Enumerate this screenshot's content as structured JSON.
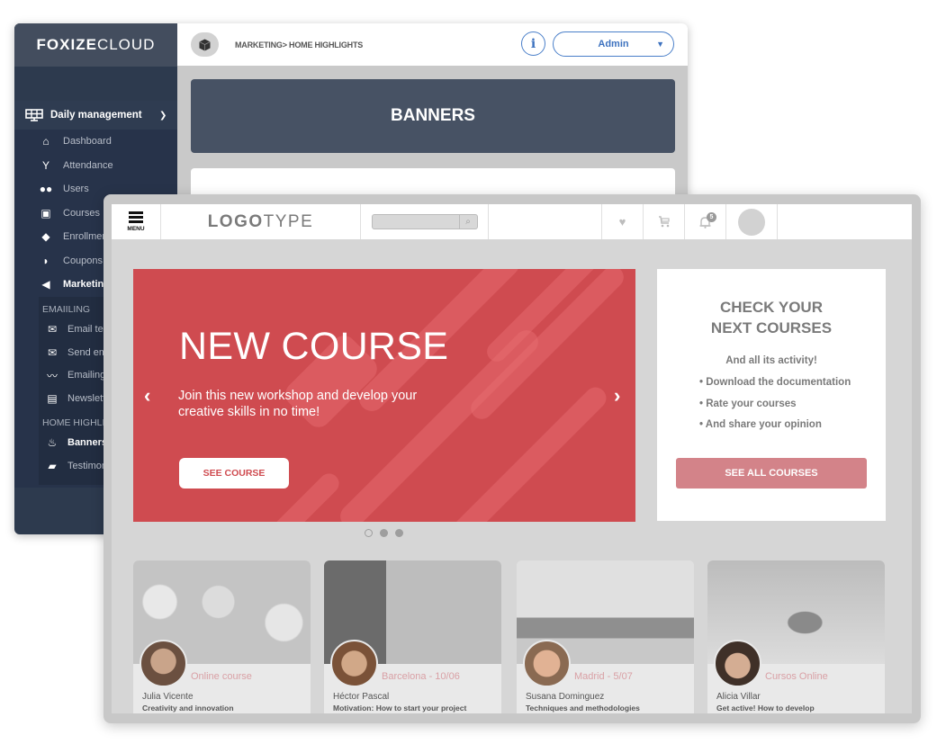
{
  "admin": {
    "brand": {
      "bold": "FOXIZE",
      "light": "CLOUD"
    },
    "sidebar": {
      "group": {
        "label": "Daily management",
        "icon": "solar-panel-icon"
      },
      "items": [
        {
          "label": "Dashboard",
          "icon": "home-icon"
        },
        {
          "label": "Attendance",
          "icon": "person-raised-icon"
        },
        {
          "label": "Users",
          "icon": "users-icon"
        },
        {
          "label": "Courses",
          "icon": "reader-icon"
        },
        {
          "label": "Enrollments",
          "icon": "graduation-cap-icon"
        },
        {
          "label": "Coupons",
          "icon": "tag-icon"
        },
        {
          "label": "Marketing",
          "icon": "megaphone-icon"
        }
      ],
      "emailing": {
        "label": "EMAIILING",
        "items": [
          {
            "label": "Email templates",
            "icon": "envelope-icon"
          },
          {
            "label": "Send emails",
            "icon": "envelope-open-icon"
          },
          {
            "label": "Emailing reports",
            "icon": "line-chart-icon"
          },
          {
            "label": "Newsletters",
            "icon": "newspaper-icon"
          }
        ]
      },
      "home_highlights": {
        "label": "HOME HIGHLIGHTS",
        "items": [
          {
            "label": "Banners",
            "icon": "fire-icon"
          },
          {
            "label": "Testimonials",
            "icon": "comment-icon"
          }
        ]
      }
    },
    "topbar": {
      "breadcrumb": "MARKETING> HOME HIGHLIGHTS",
      "info_label": "i",
      "user_label": "Admin"
    },
    "page_title": "BANNERS"
  },
  "site": {
    "header": {
      "menu_label": "MENU",
      "logo": {
        "bold": "LOGO",
        "light": "TYPE"
      },
      "search_placeholder": "",
      "notification_count": "5"
    },
    "hero": {
      "title": "NEW COURSE",
      "subtitle": "Join this new workshop and develop your creative skills in no time!",
      "button": "SEE COURSE",
      "prev": "‹",
      "next": "›",
      "slides": 3,
      "active_slide": 1
    },
    "promo": {
      "title_line1": "CHECK YOUR",
      "title_line2": "NEXT COURSES",
      "subtitle": "And all its activity!",
      "list": [
        "• Download the documentation",
        "• Rate your courses",
        "• And share your opinion"
      ],
      "button": "SEE ALL COURSES"
    },
    "cards": [
      {
        "tag": "Online course",
        "name": "Julia Vicente",
        "course": "Creativity and innovation"
      },
      {
        "tag": "Barcelona - 10/06",
        "name": "Héctor Pascal",
        "course": "Motivation: How to start your project"
      },
      {
        "tag": "Madrid - 5/07",
        "name": "Susana Dominguez",
        "course": "Techniques and methodologies"
      },
      {
        "tag": "Cursos Online",
        "name": "Alicia Villar",
        "course": "Get active! How to develop"
      }
    ],
    "colors": {
      "accent": "#cf4b50",
      "muted_accent": "#d38389",
      "admin_dark": "#2d3a4e",
      "admin_link": "#3d72bf"
    }
  }
}
